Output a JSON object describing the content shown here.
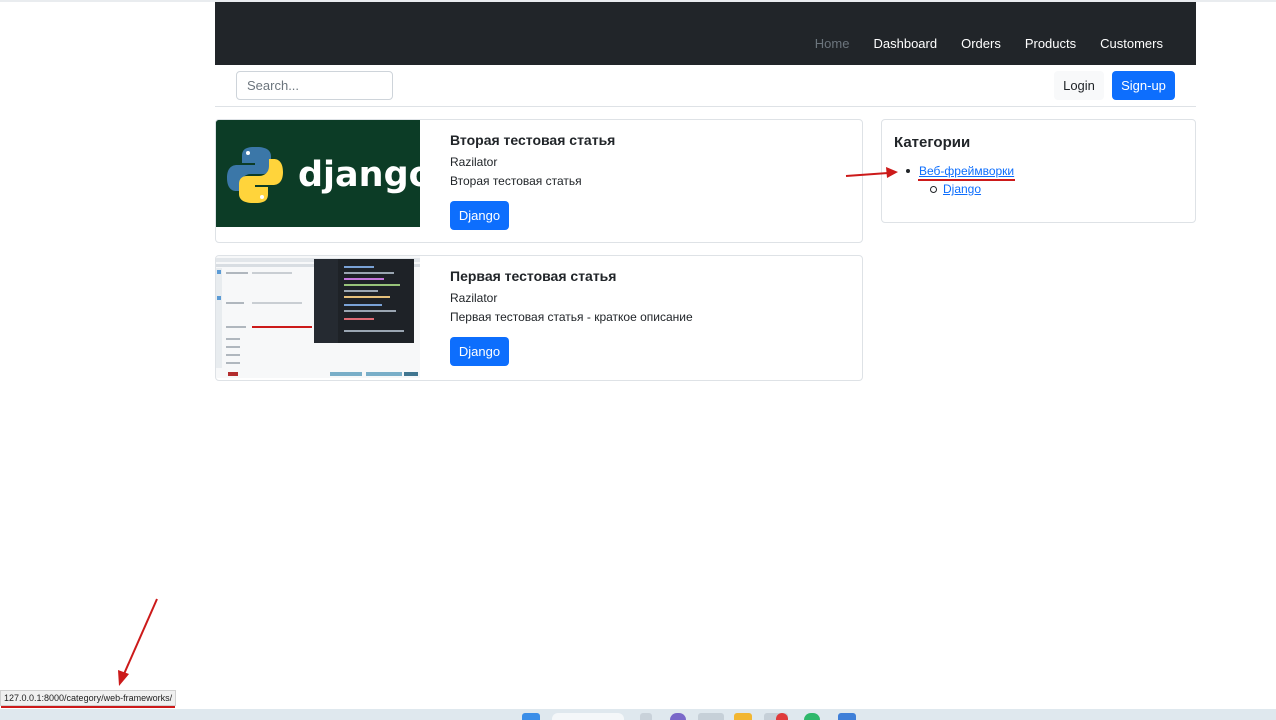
{
  "navbar": {
    "links": [
      {
        "label": "Home",
        "active": false
      },
      {
        "label": "Dashboard"
      },
      {
        "label": "Orders"
      },
      {
        "label": "Products"
      },
      {
        "label": "Customers"
      }
    ]
  },
  "search": {
    "placeholder": "Search..."
  },
  "auth": {
    "login_label": "Login",
    "signup_label": "Sign-up"
  },
  "articles": [
    {
      "title": "Вторая тестовая статья",
      "author": "Razilator",
      "description": "Вторая тестовая статья",
      "tag": "Django",
      "thumb_text": "django"
    },
    {
      "title": "Первая тестовая статья",
      "author": "Razilator",
      "description": "Первая тестовая статья - краткое описание",
      "tag": "Django"
    }
  ],
  "categories": {
    "title": "Категории",
    "items": [
      {
        "label": "Веб-фреймворки",
        "children": [
          {
            "label": "Django"
          }
        ]
      }
    ]
  },
  "status_bar": {
    "url": "127.0.0.1:8000/category/web-frameworks/"
  },
  "colors": {
    "primary": "#0d6efd",
    "navbar": "#212529",
    "annotation": "#cc1a1a",
    "django_green": "#0c3c26"
  }
}
